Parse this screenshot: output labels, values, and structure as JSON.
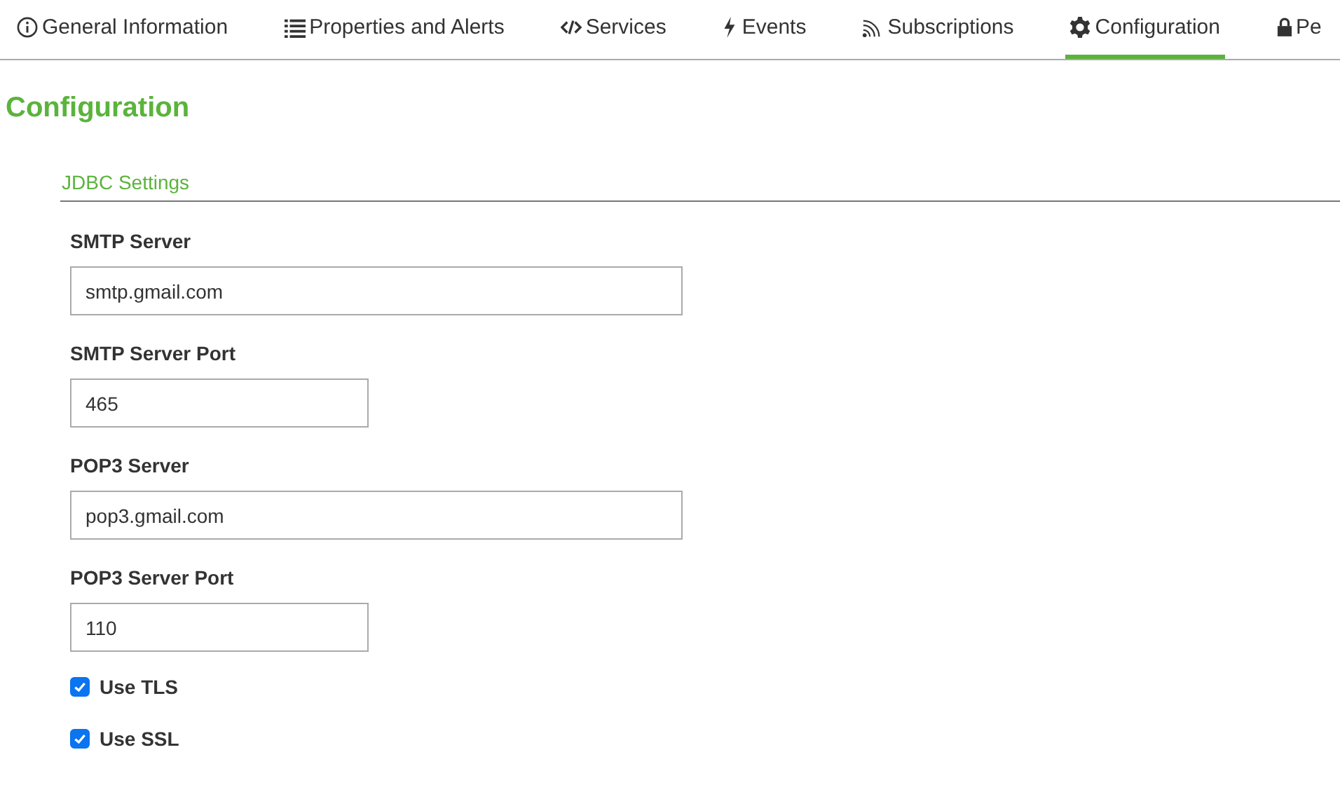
{
  "tabs": [
    {
      "label": "General Information",
      "kind": "info",
      "selected": false
    },
    {
      "label": "Properties and Alerts",
      "kind": "list",
      "selected": false
    },
    {
      "label": "Services",
      "kind": "code",
      "selected": false
    },
    {
      "label": "Events",
      "kind": "bolt",
      "selected": false
    },
    {
      "label": "Subscriptions",
      "kind": "feed",
      "selected": false
    },
    {
      "label": "Configuration",
      "kind": "gear",
      "selected": true
    },
    {
      "label": "Pe",
      "kind": "lock",
      "selected": false
    }
  ],
  "heading": "Configuration",
  "section": {
    "title": "JDBC Settings",
    "fields": [
      {
        "kind": "text",
        "label": "SMTP Server",
        "value": "smtp.gmail.com"
      },
      {
        "kind": "number",
        "label": "SMTP Server Port",
        "value": "465"
      },
      {
        "kind": "text",
        "label": "POP3 Server",
        "value": "pop3.gmail.com"
      },
      {
        "kind": "number",
        "label": "POP3 Server Port",
        "value": "110"
      },
      {
        "kind": "checkbox",
        "label": "Use TLS",
        "checked": true
      },
      {
        "kind": "checkbox",
        "label": "Use SSL",
        "checked": true
      }
    ]
  }
}
